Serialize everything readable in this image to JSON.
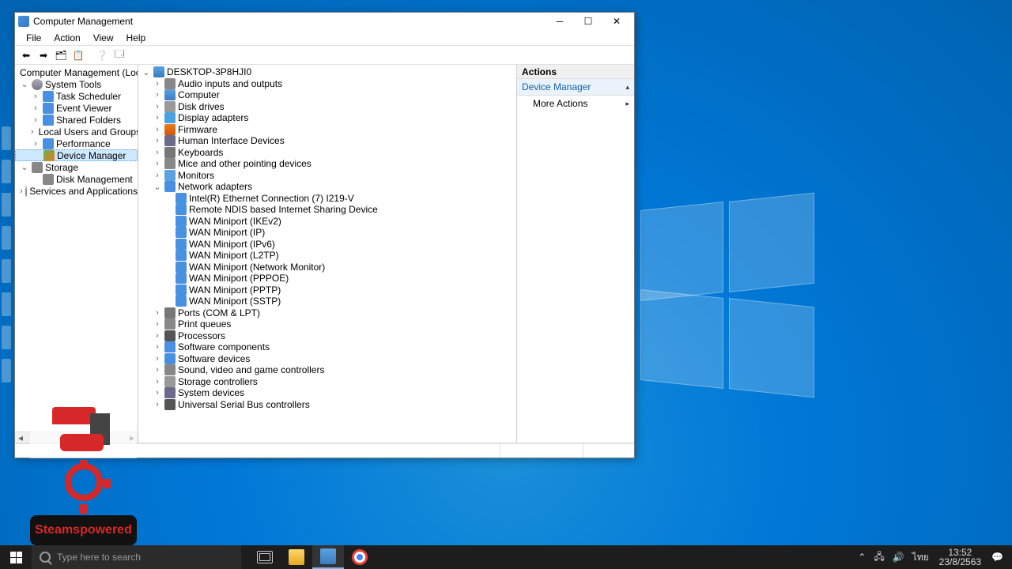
{
  "window": {
    "title": "Computer Management"
  },
  "menu": {
    "file": "File",
    "action": "Action",
    "view": "View",
    "help": "Help"
  },
  "leftTree": {
    "root": "Computer Management (Local",
    "sysTools": "System Tools",
    "taskSched": "Task Scheduler",
    "eventViewer": "Event Viewer",
    "sharedFolders": "Shared Folders",
    "localUsers": "Local Users and Groups",
    "performance": "Performance",
    "deviceManager": "Device Manager",
    "storage": "Storage",
    "diskMgmt": "Disk Management",
    "services": "Services and Applications"
  },
  "devices": {
    "root": "DESKTOP-3P8HJI0",
    "audio": "Audio inputs and outputs",
    "computer": "Computer",
    "diskDrives": "Disk drives",
    "display": "Display adapters",
    "firmware": "Firmware",
    "hid": "Human Interface Devices",
    "keyboards": "Keyboards",
    "mice": "Mice and other pointing devices",
    "monitors": "Monitors",
    "netadapters": "Network adapters",
    "na0": "Intel(R) Ethernet Connection (7) I219-V",
    "na1": "Remote NDIS based Internet Sharing Device",
    "na2": "WAN Miniport (IKEv2)",
    "na3": "WAN Miniport (IP)",
    "na4": "WAN Miniport (IPv6)",
    "na5": "WAN Miniport (L2TP)",
    "na6": "WAN Miniport (Network Monitor)",
    "na7": "WAN Miniport (PPPOE)",
    "na8": "WAN Miniport (PPTP)",
    "na9": "WAN Miniport (SSTP)",
    "ports": "Ports (COM & LPT)",
    "printq": "Print queues",
    "processors": "Processors",
    "swcomp": "Software components",
    "swdev": "Software devices",
    "sound": "Sound, video and game controllers",
    "storctrl": "Storage controllers",
    "sysdev": "System devices",
    "usb": "Universal Serial Bus controllers"
  },
  "actions": {
    "header": "Actions",
    "section": "Device Manager",
    "more": "More Actions"
  },
  "taskbar": {
    "search_placeholder": "Type here to search",
    "time": "13:52",
    "date": "23/8/2563",
    "lang": "ไทย"
  },
  "overlay": {
    "label": "Steamspowered"
  }
}
